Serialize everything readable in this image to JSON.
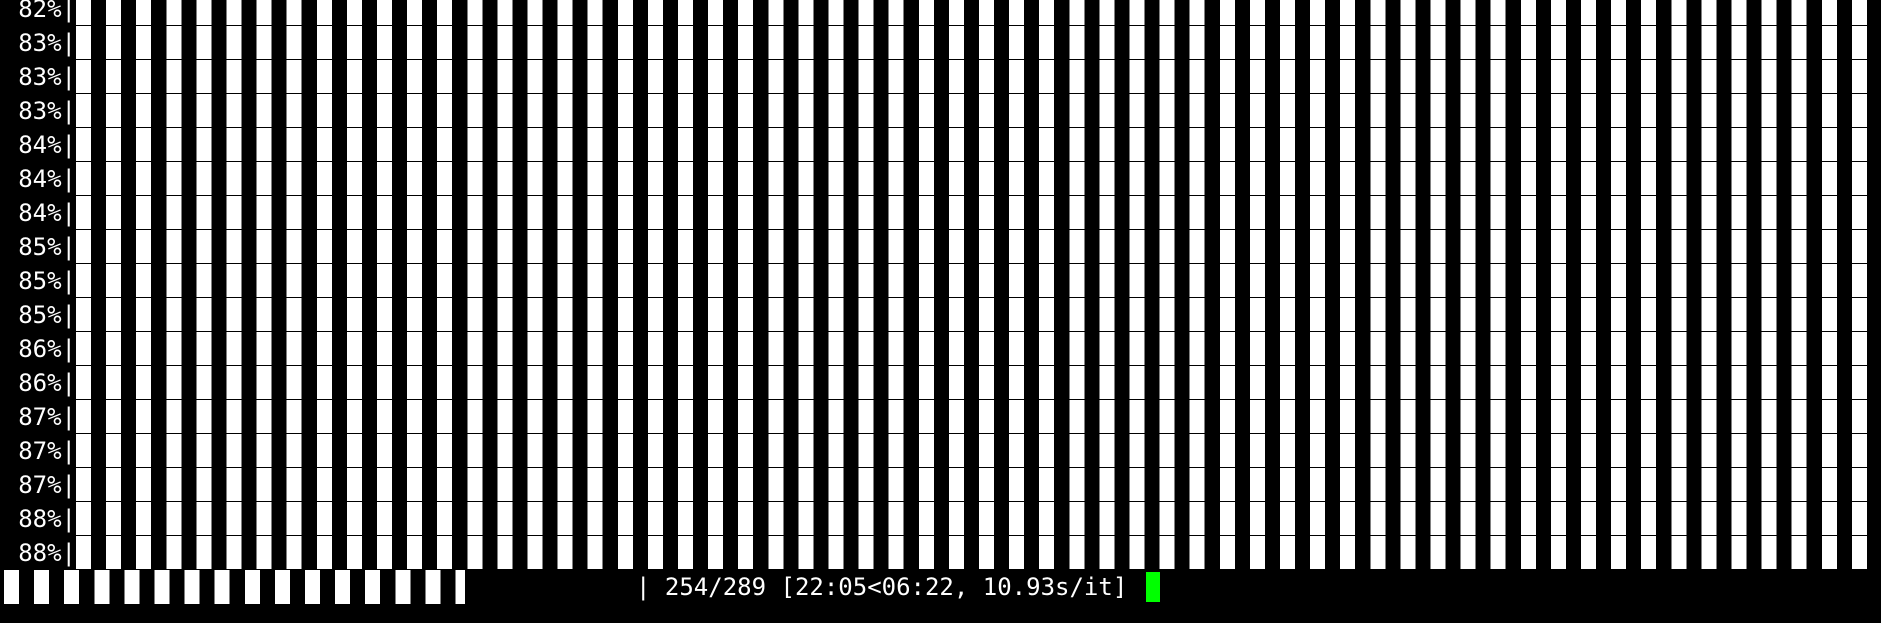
{
  "terminal": {
    "background": "#000000",
    "foreground": "#ffffff",
    "cursor_color": "#00ff00",
    "lines": [
      {
        "percent": "82%|"
      },
      {
        "percent": "83%|"
      },
      {
        "percent": "83%|"
      },
      {
        "percent": "83%|"
      },
      {
        "percent": "84%|"
      },
      {
        "percent": "84%|"
      },
      {
        "percent": "84%|"
      },
      {
        "percent": "85%|"
      },
      {
        "percent": "85%|"
      },
      {
        "percent": "85%|"
      },
      {
        "percent": "86%|"
      },
      {
        "percent": "86%|"
      },
      {
        "percent": "87%|"
      },
      {
        "percent": "87%|"
      },
      {
        "percent": "87%|"
      },
      {
        "percent": "88%|"
      },
      {
        "percent": "88%|"
      }
    ],
    "current": {
      "status": "| 254/289 [22:05<06:22, 10.93s/it]",
      "completed": 254,
      "total": 289,
      "elapsed": "22:05",
      "remaining": "06:22",
      "rate": "10.93s/it"
    }
  }
}
